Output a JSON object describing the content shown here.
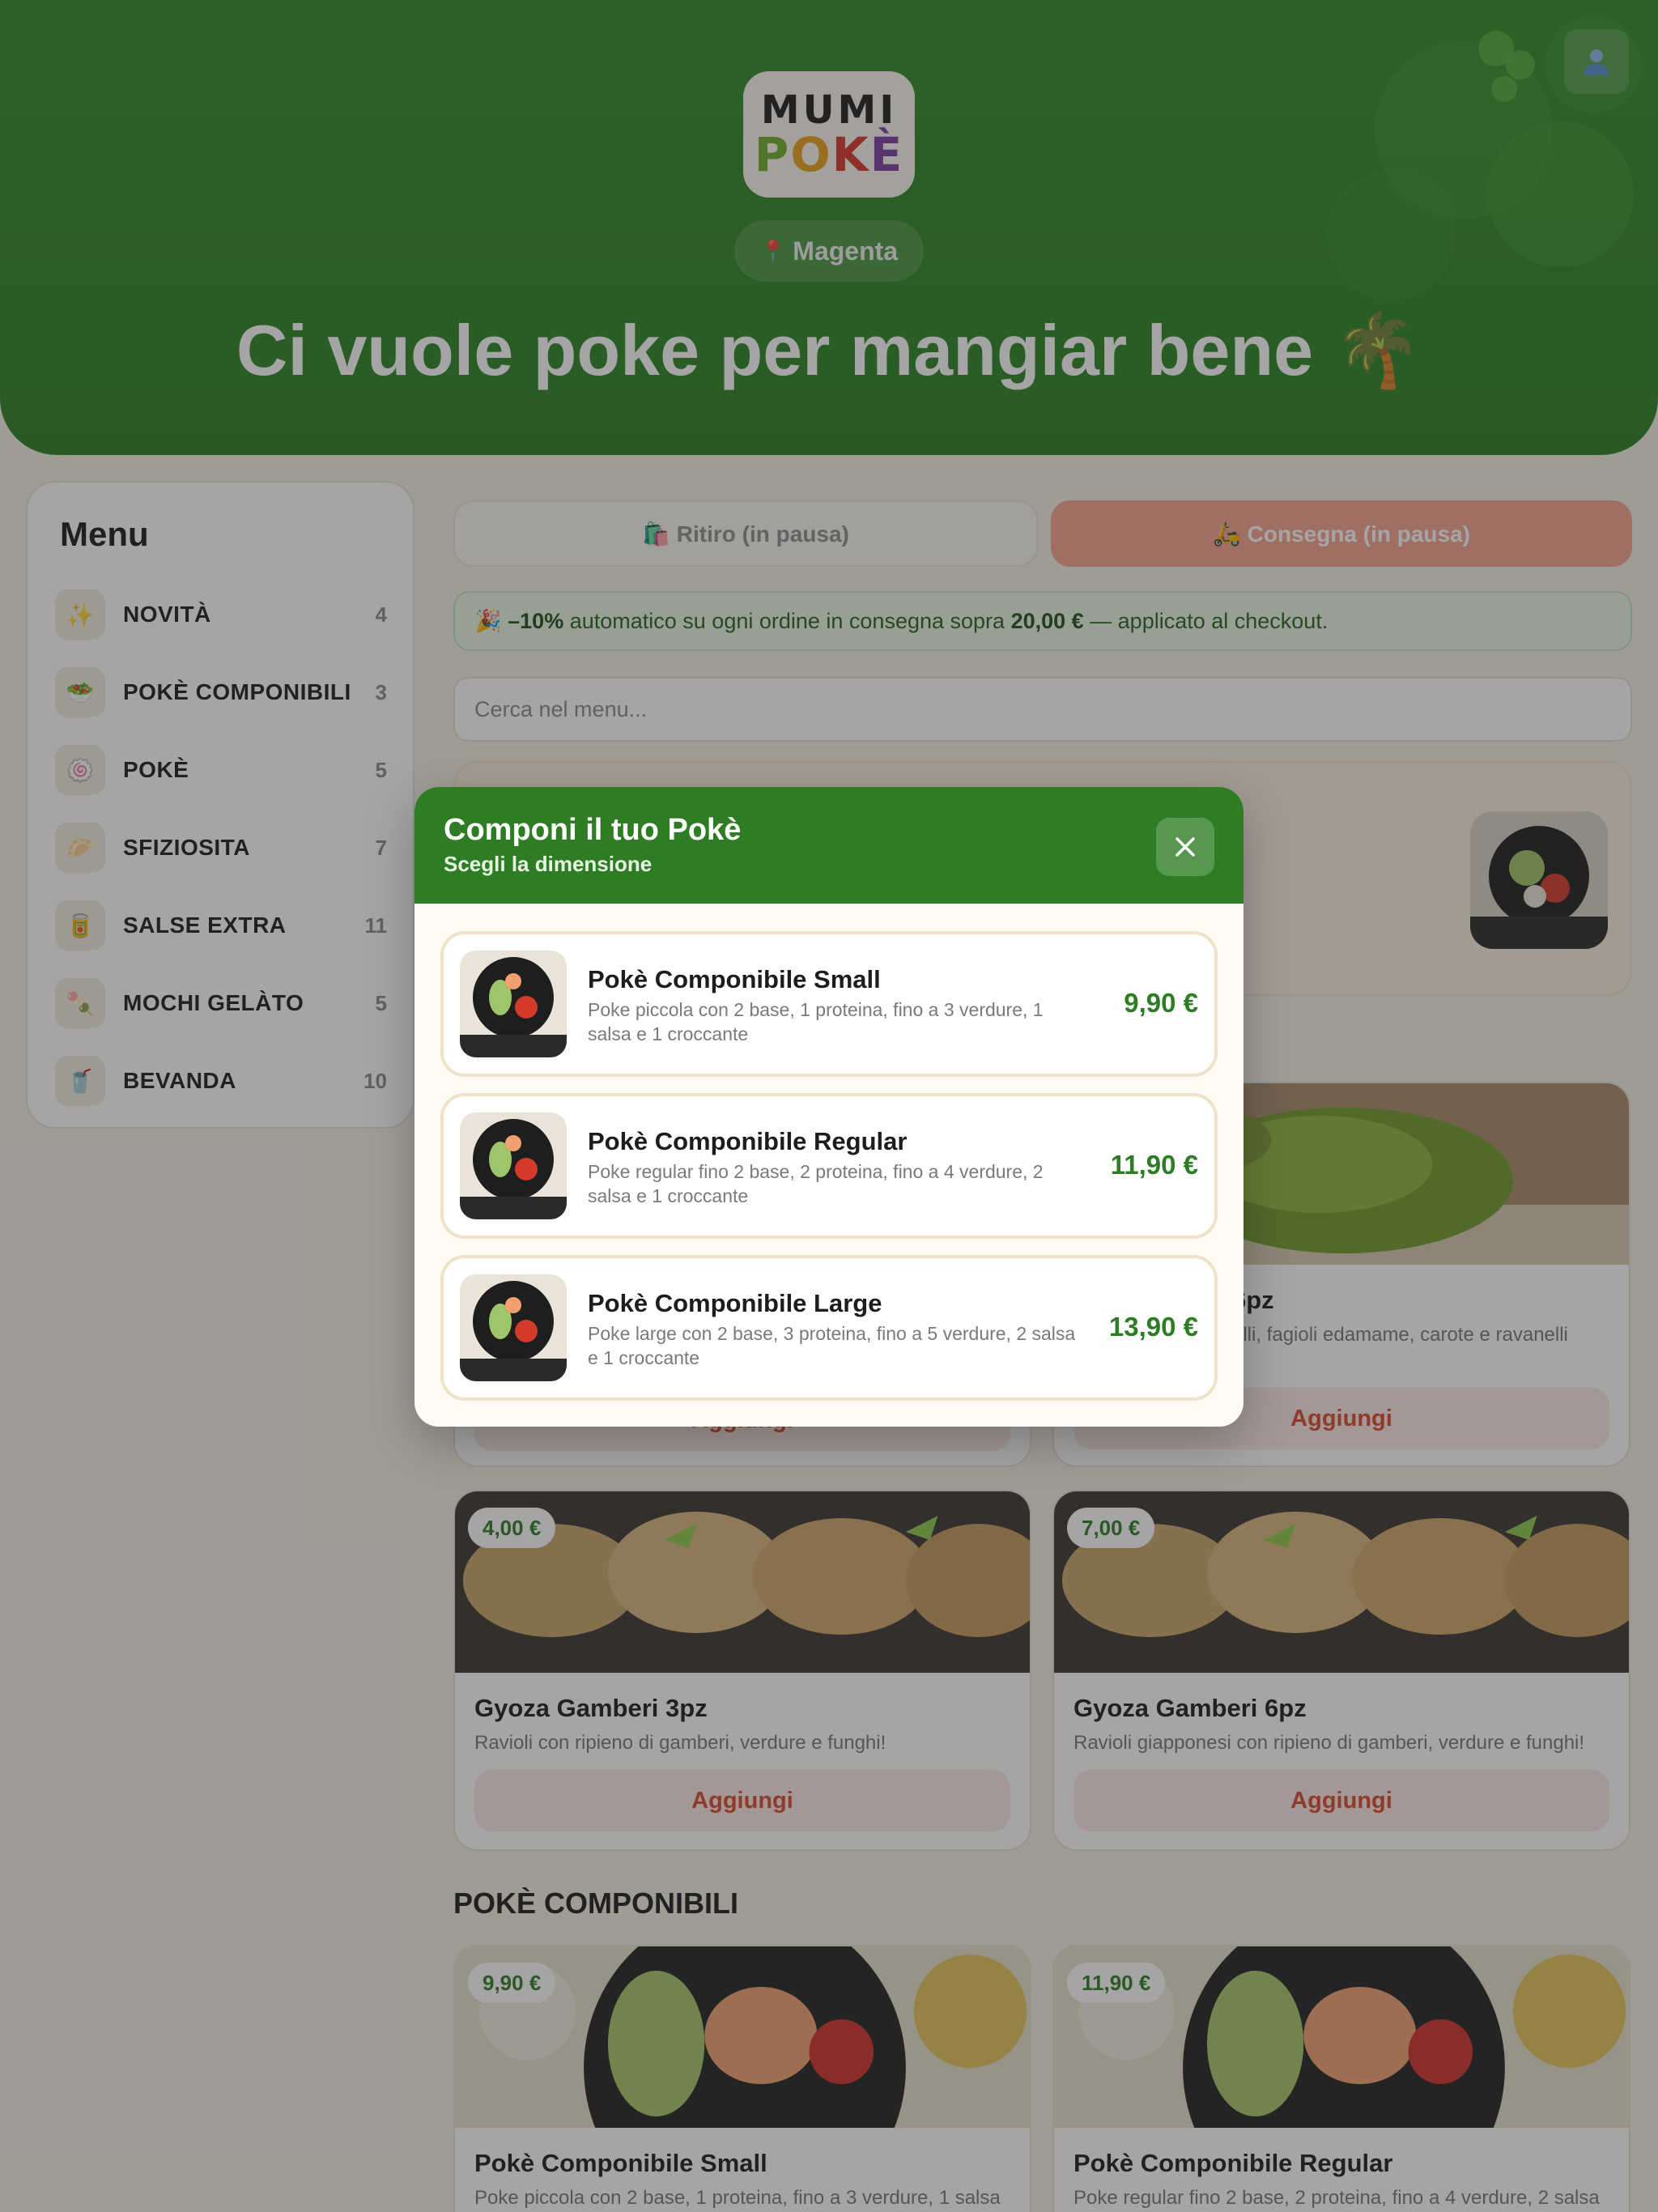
{
  "header": {
    "logo_top": "MUMI",
    "logo_bottom": "POKÈ",
    "location": "Magenta",
    "tagline": "Ci vuole poke per mangiar bene 🌴"
  },
  "sidebar": {
    "title": "Menu",
    "items": [
      {
        "label": "NOVITÀ",
        "count": "4",
        "icon": "sparkles-icon",
        "glyph": "✨"
      },
      {
        "label": "POKÈ COMPONIBILI",
        "count": "3",
        "icon": "bowl-icon",
        "glyph": "🥗"
      },
      {
        "label": "POKÈ",
        "count": "5",
        "icon": "fishcake-icon",
        "glyph": "🍥"
      },
      {
        "label": "SFIZIOSITA",
        "count": "7",
        "icon": "dumpling-icon",
        "glyph": "🥟"
      },
      {
        "label": "SALSE EXTRA",
        "count": "11",
        "icon": "jar-icon",
        "glyph": "🥫"
      },
      {
        "label": "MOCHI GELÀTO",
        "count": "5",
        "icon": "dango-icon",
        "glyph": "🍡"
      },
      {
        "label": "BEVANDA",
        "count": "10",
        "icon": "cup-icon",
        "glyph": "🥤"
      }
    ]
  },
  "order_mode": {
    "pickup": "🛍️ Ritiro (in pausa)",
    "delivery": "🛵 Consegna (in pausa)"
  },
  "promo": {
    "icon": "🎉",
    "discount": "–10%",
    "text_a": " automatico su ogni ordine in consegna sopra ",
    "threshold": "20,00 €",
    "text_b": " — applicato al checkout."
  },
  "search": {
    "placeholder": "Cerca nel menu..."
  },
  "cards": [
    {
      "title": "",
      "price": "",
      "desc": "",
      "button": "Aggiungi"
    },
    {
      "title": "6pz",
      "price": "",
      "desc": "elli, fagioli edamame, carote e ravanelli",
      "button": "Aggiungi"
    },
    {
      "title": "Gyoza Gamberi 3pz",
      "price": "4,00 €",
      "desc": "Ravioli con ripieno di gamberi, verdure e funghi!",
      "button": "Aggiungi"
    },
    {
      "title": "Gyoza Gamberi 6pz",
      "price": "7,00 €",
      "desc": "Ravioli giapponesi con ripieno di gamberi, verdure e funghi!",
      "button": "Aggiungi"
    },
    {
      "title": "Pokè Componibile Small",
      "price": "9,90 €",
      "desc": "Poke piccola con 2 base, 1 proteina, fino a 3 verdure, 1 salsa"
    },
    {
      "title": "Pokè Componibile Regular",
      "price": "11,90 €",
      "desc": "Poke regular fino 2 base, 2 proteina, fino a 4 verdure, 2 salsa"
    }
  ],
  "sections": {
    "poke_componibili": "POKÈ COMPONIBILI"
  },
  "modal": {
    "title": "Componi il tuo Pokè",
    "subtitle": "Scegli la dimensione",
    "options": [
      {
        "title": "Pokè Componibile Small",
        "desc": "Poke piccola con 2 base, 1 proteina, fino a 3 verdure, 1 salsa e 1 croccante",
        "price": "9,90 €"
      },
      {
        "title": "Pokè Componibile Regular",
        "desc": "Poke regular fino 2 base, 2 proteina, fino a 4 verdure, 2 salsa e 1 croccante",
        "price": "11,90 €"
      },
      {
        "title": "Pokè Componibile Large",
        "desc": "Poke large con 2 base, 3 proteina, fino a 5 verdure, 2 salsa e 1 croccante",
        "price": "13,90 €"
      }
    ]
  },
  "colors": {
    "brand_green": "#2e7d25",
    "accent_red": "#d9472e",
    "delivery_button": "#f6a28e",
    "background": "#f4efe6"
  }
}
